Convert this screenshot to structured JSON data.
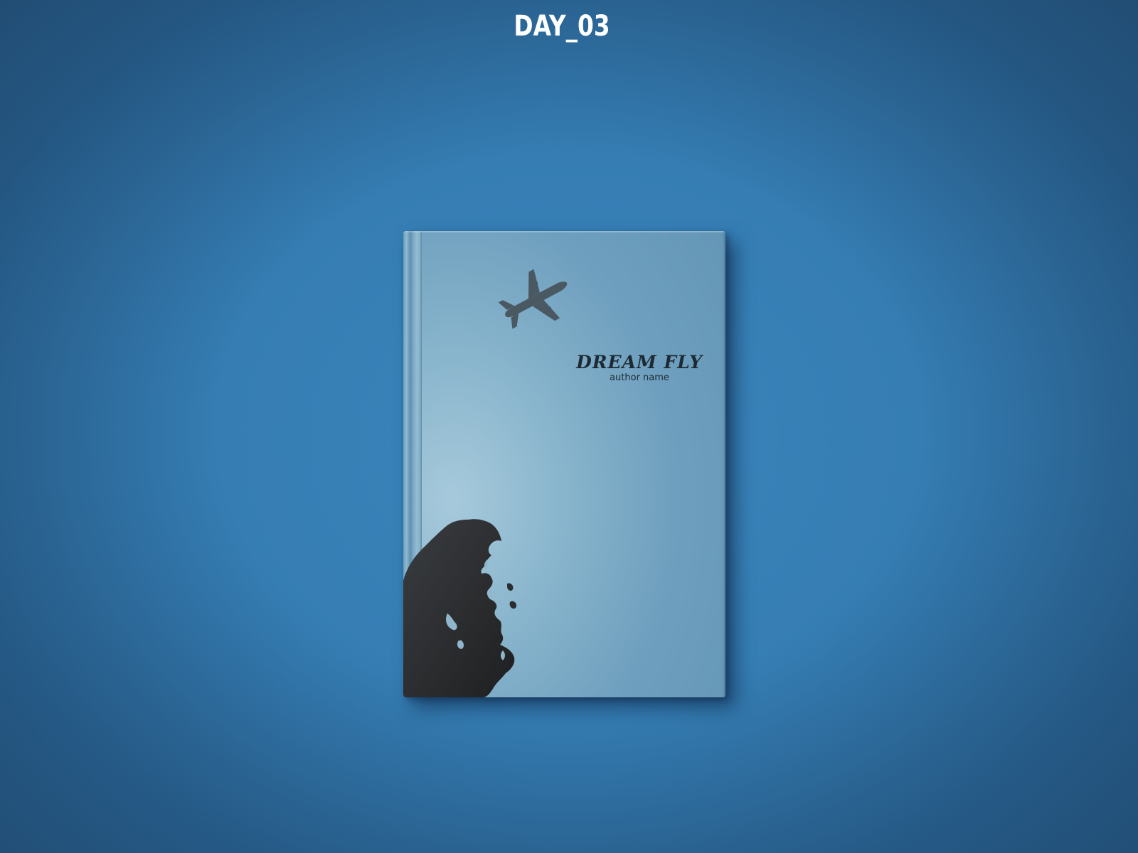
{
  "header": {
    "title": "DAY_03"
  },
  "book": {
    "title": "DREAM FLY",
    "author": "author name",
    "cover_color": "#7aa9c6",
    "ink_color": "#2b2b2b"
  },
  "background": {
    "color": "#357db3"
  },
  "icons": {
    "airplane": "airplane-icon",
    "silhouette": "head-silhouette-illustration"
  }
}
